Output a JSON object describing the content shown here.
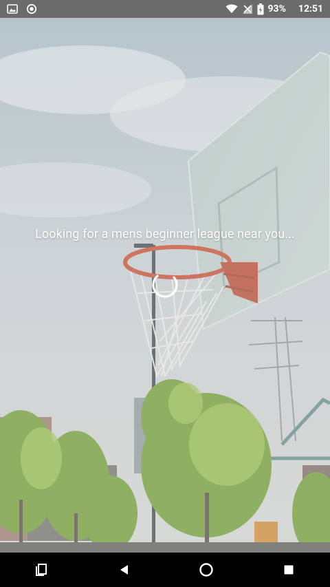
{
  "status_bar": {
    "battery": "93%",
    "time": "12:51",
    "icons": [
      "image-icon",
      "record-icon",
      "wifi-icon",
      "no-signal-icon",
      "battery-icon"
    ]
  },
  "main": {
    "loading_text": "Looking for a mens beginner league near you..."
  },
  "nav_bar": {
    "buttons": [
      "recents-button",
      "back-button",
      "home-button",
      "overview-button"
    ]
  },
  "colors": {
    "overlay": "#dcdcdc",
    "rim": "#c84a2c",
    "spinner": "#ffffff"
  }
}
